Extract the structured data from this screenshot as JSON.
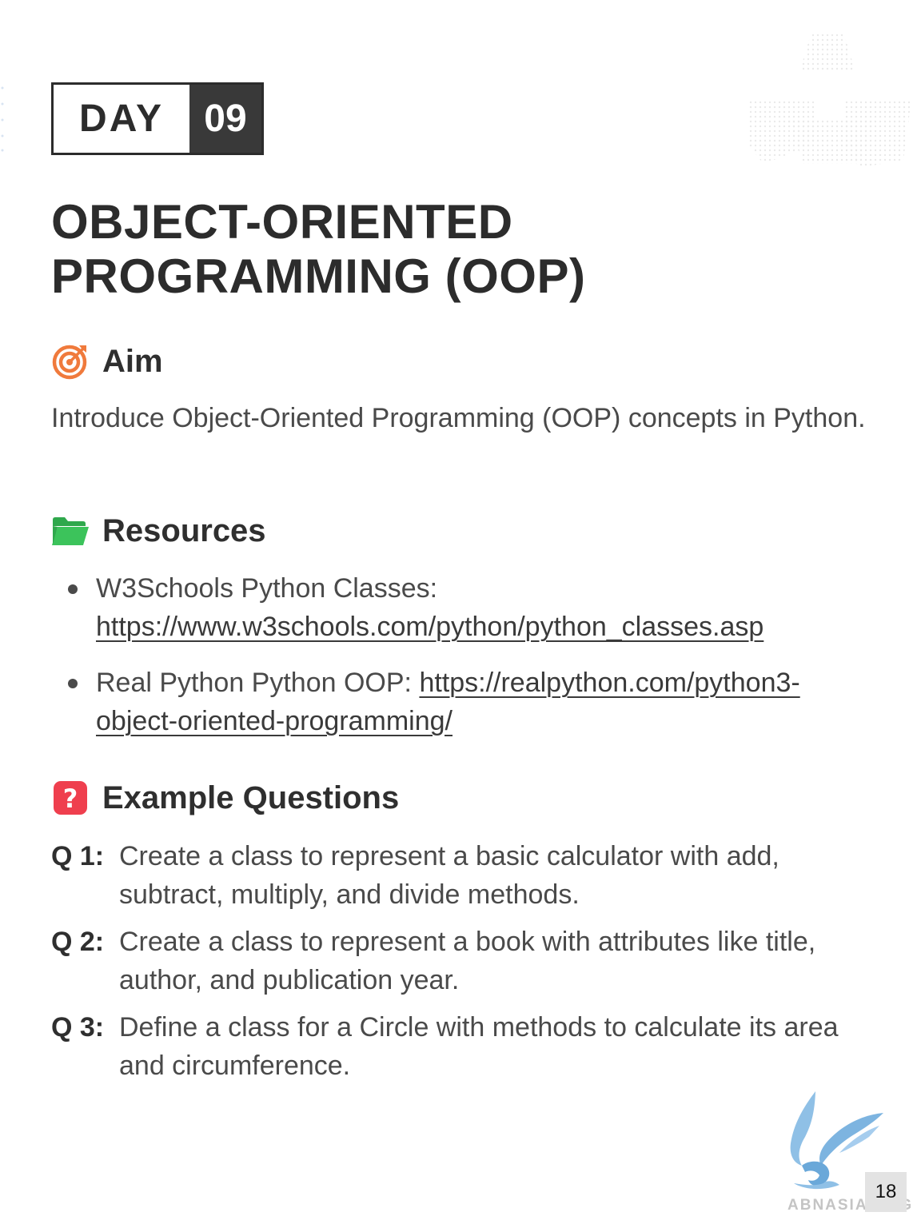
{
  "badge": {
    "day_word": "DAY",
    "day_number": "09"
  },
  "title": {
    "line1": "OBJECT-ORIENTED",
    "line2": "PROGRAMMING (OOP)"
  },
  "aim": {
    "heading": "Aim",
    "icon": "target-icon",
    "text": "Introduce Object-Oriented Programming (OOP) concepts in Python."
  },
  "resources": {
    "heading": "Resources",
    "icon": "folder-icon",
    "items": [
      {
        "label": "W3Schools Python Classes: ",
        "link": "https://www.w3schools.com/python/python_classes.asp"
      },
      {
        "label": "Real Python Python OOP: ",
        "link": "https://realpython.com/python3-object-oriented-programming/"
      }
    ]
  },
  "questions": {
    "heading": "Example Questions",
    "icon": "question-icon",
    "items": [
      {
        "num": "Q 1:",
        "text": "Create a class to represent a basic calculator with add, subtract, multiply, and divide methods."
      },
      {
        "num": "Q 2:",
        "text": "Create a class to represent a book with attributes like title, author, and publication year."
      },
      {
        "num": "Q 3:",
        "text": "Define a class for a Circle with methods to calculate its area and circumference."
      }
    ]
  },
  "footer": {
    "org": "ABNASIA.ORG",
    "page_number": "18"
  },
  "colors": {
    "accent_orange": "#f07a3c",
    "folder_green": "#3cc35b",
    "question_red": "#ef3f4e",
    "badge_dark": "#393939"
  }
}
